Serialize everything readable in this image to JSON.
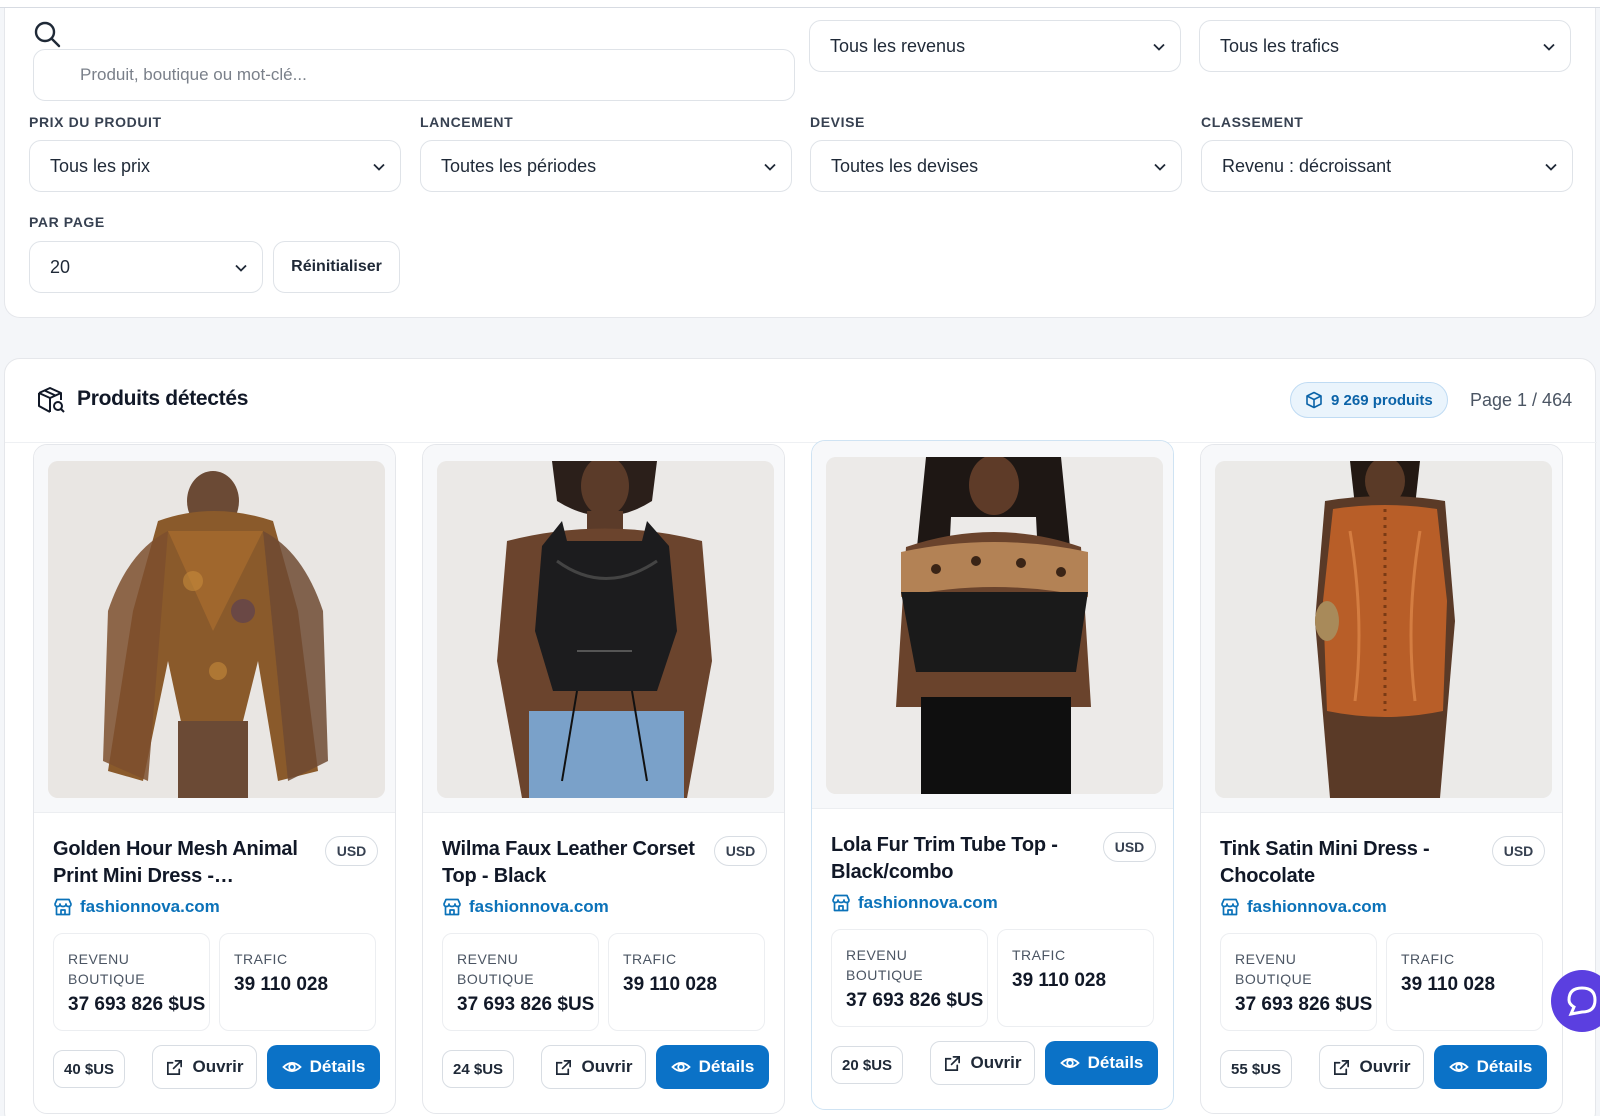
{
  "search": {
    "placeholder": "Produit, boutique ou mot-clé..."
  },
  "filters": {
    "revenus": "Tous les revenus",
    "trafics": "Tous les trafics",
    "prix_label": "PRIX DU PRODUIT",
    "prix_value": "Tous les prix",
    "lancement_label": "LANCEMENT",
    "lancement_value": "Toutes les périodes",
    "devise_label": "DEVISE",
    "devise_value": "Toutes les devises",
    "classement_label": "CLASSEMENT",
    "classement_value": "Revenu : décroissant",
    "par_page_label": "PAR PAGE",
    "par_page_value": "20",
    "reset_label": "Réinitialiser"
  },
  "products": {
    "title": "Produits détectés",
    "count_label": "9 269 produits",
    "page_info": "Page 1 / 464",
    "stat_labels": {
      "revenue_line1": "REVENU",
      "revenue_line2": "BOUTIQUE",
      "traffic": "TRAFIC"
    },
    "open_label": "Ouvrir",
    "details_label": "Détails",
    "items": [
      {
        "name": "Golden Hour Mesh Animal Print Mini Dress - Brown/combo",
        "currency": "USD",
        "shop": "fashionnova.com",
        "revenue": "37 693 826 $US",
        "traffic": "39 110 028",
        "price": "40 $US"
      },
      {
        "name": "Wilma Faux Leather Corset Top - Black",
        "currency": "USD",
        "shop": "fashionnova.com",
        "revenue": "37 693 826 $US",
        "traffic": "39 110 028",
        "price": "24 $US"
      },
      {
        "name": "Lola Fur Trim Tube Top - Black/combo",
        "currency": "USD",
        "shop": "fashionnova.com",
        "revenue": "37 693 826 $US",
        "traffic": "39 110 028",
        "price": "20 $US"
      },
      {
        "name": "Tink Satin Mini Dress - Chocolate",
        "currency": "USD",
        "shop": "fashionnova.com",
        "revenue": "37 693 826 $US",
        "traffic": "39 110 028",
        "price": "55 $US"
      }
    ]
  },
  "colors": {
    "accent": "#0b72c7",
    "link": "#0b72b9",
    "chat": "#5b3fe0"
  }
}
